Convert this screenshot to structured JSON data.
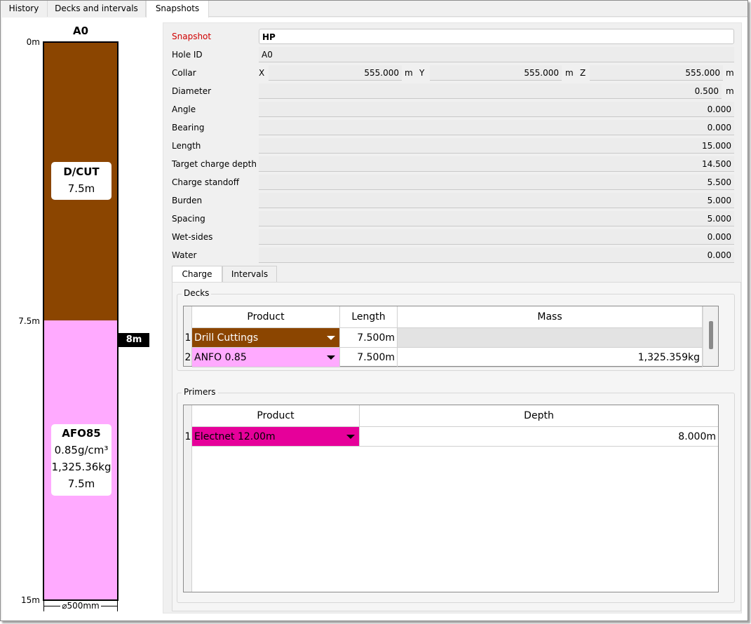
{
  "tabs": {
    "history": "History",
    "decks": "Decks and intervals",
    "snapshots": "Snapshots"
  },
  "hole": {
    "title": "A0",
    "depth_top": "0m",
    "depth_mid": "7.5m",
    "depth_bottom": "15m",
    "seg1_name": "D/CUT",
    "seg1_length": "7.5m",
    "seg2_name": "AFO85",
    "seg2_density": "0.85g/cm³",
    "seg2_mass": "1,325.36kg",
    "seg2_length": "7.5m",
    "primer_marker": "8m",
    "diameter_label": "⌀500mm",
    "colors": {
      "seg1": "#8b4500",
      "seg2": "#ffaaff"
    }
  },
  "fields": {
    "snapshot_label": "Snapshot",
    "snapshot_value": "HP",
    "holeid_label": "Hole ID",
    "holeid_value": "A0",
    "collar_label": "Collar",
    "x_label": "X",
    "x_value": "555.000",
    "y_label": "Y",
    "y_value": "555.000",
    "z_label": "Z",
    "z_value": "555.000",
    "unit_m": "m",
    "diameter_label": "Diameter",
    "diameter_value": "0.500",
    "angle_label": "Angle",
    "angle_value": "0.000",
    "bearing_label": "Bearing",
    "bearing_value": "0.000",
    "length_label": "Length",
    "length_value": "15.000",
    "target_label": "Target charge depth",
    "target_value": "14.500",
    "standoff_label": "Charge standoff",
    "standoff_value": "5.500",
    "burden_label": "Burden",
    "burden_value": "5.000",
    "spacing_label": "Spacing",
    "spacing_value": "5.000",
    "wetsides_label": "Wet-sides",
    "wetsides_value": "0.000",
    "water_label": "Water",
    "water_value": "0.000"
  },
  "inner_tabs": {
    "charge": "Charge",
    "intervals": "Intervals"
  },
  "decks": {
    "title": "Decks",
    "headers": {
      "product": "Product",
      "length": "Length",
      "mass": "Mass"
    },
    "rows": [
      {
        "num": "1",
        "product": "Drill Cuttings",
        "length": "7.500m",
        "mass": "",
        "color": "#8b4500"
      },
      {
        "num": "2",
        "product": "ANFO 0.85",
        "length": "7.500m",
        "mass": "1,325.359kg",
        "color": "#ffaaff"
      }
    ]
  },
  "primers": {
    "title": "Primers",
    "headers": {
      "product": "Product",
      "depth": "Depth"
    },
    "rows": [
      {
        "num": "1",
        "product": "Electnet 12.00m",
        "depth": "8.000m",
        "color": "#e6009a"
      }
    ]
  }
}
